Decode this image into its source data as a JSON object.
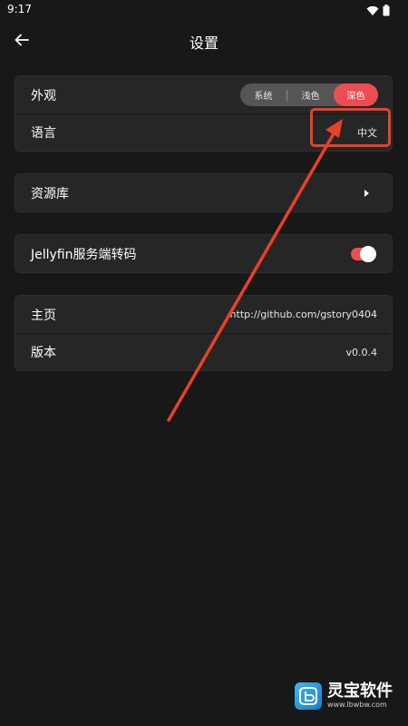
{
  "status_bar": {
    "time": "9:17",
    "icons": [
      "wifi-icon",
      "battery-icon"
    ]
  },
  "header": {
    "title": "设置"
  },
  "settings": {
    "appearance": {
      "label": "外观",
      "options": [
        "系统",
        "浅色",
        "深色"
      ],
      "selected": "深色"
    },
    "language": {
      "label": "语言",
      "value": "中文"
    },
    "library": {
      "label": "资源库"
    },
    "transcode": {
      "label": "Jellyfin服务端转码",
      "enabled": true
    },
    "homepage": {
      "label": "主页",
      "value": "http://github.com/gstory0404"
    },
    "version": {
      "label": "版本",
      "value": "v0.0.4"
    }
  },
  "watermark": {
    "name": "灵宝软件",
    "url": "www.lbwbw.com"
  },
  "colors": {
    "background": "#181818",
    "card": "#262626",
    "accent": "#ec4d51",
    "annotation": "#e9402a"
  }
}
